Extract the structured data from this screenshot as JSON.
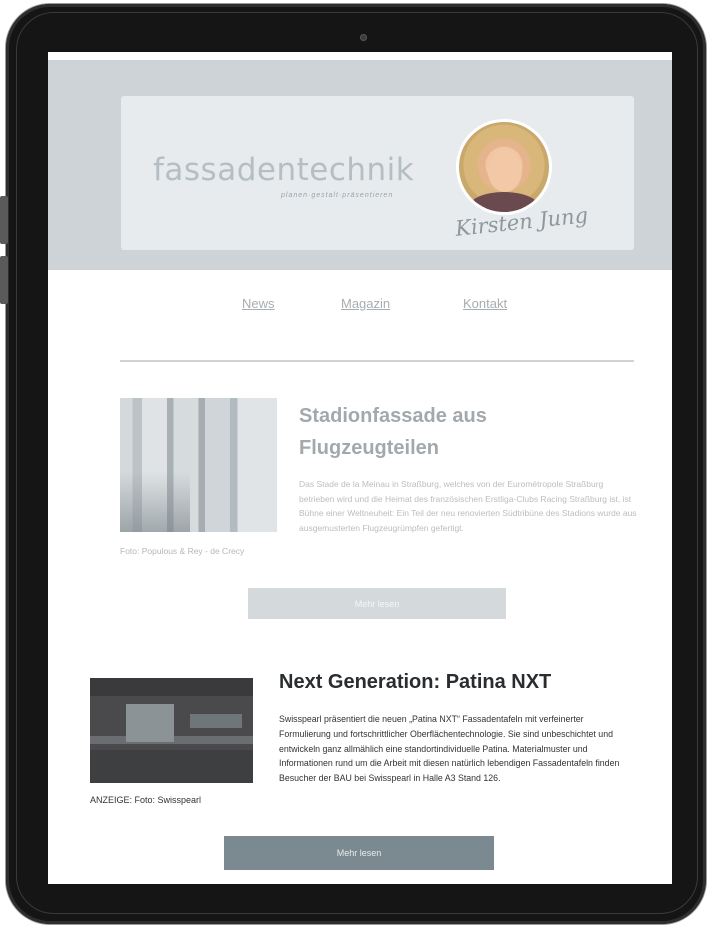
{
  "header": {
    "logo": "fassadentechnik",
    "tagline": "planen·gestalt·präsentieren",
    "signature": "Kirsten Jung"
  },
  "nav": {
    "items": [
      {
        "label": "News"
      },
      {
        "label": "Magazin"
      },
      {
        "label": "Kontakt"
      }
    ]
  },
  "article1": {
    "title": "Stadionfassade aus Flugzeugteilen",
    "caption": "Foto: Populous & Rey - de Crecy",
    "body": "Das Stade de la Meinau in Straßburg, welches von der Eurométropole Straßburg betrieben wird und die Heimat des französischen Erstliga-Clubs Racing Straßburg ist, ist Bühne einer Weltneuheit: Ein Teil der neu renovierten Südtribüne des Stadions wurde aus ausgemusterten Flugzeugrümpfen gefertigt.",
    "button": "Mehr lesen"
  },
  "article2": {
    "title": "Next Generation: Patina NXT",
    "caption": "ANZEIGE: Foto: Swisspearl",
    "body": "Swisspearl präsentiert die neuen „Patina NXT“ Fassadentafeln mit verfeinerter Formulierung und fortschrittlicher Oberflächentechnologie. Sie sind unbeschichtet und entwickeln ganz allmählich eine standortindividuelle Patina. Materialmuster und Informationen rund um die Arbeit mit diesen natürlich lebendigen Fassadentafeln finden Besucher der BAU bei Swisspearl in Halle A3 Stand 126.",
    "button": "Mehr lesen"
  },
  "colors": {
    "header_band": "#cdd3d6",
    "button_light": "#d4d9dc",
    "button_dark": "#7a8a90"
  }
}
